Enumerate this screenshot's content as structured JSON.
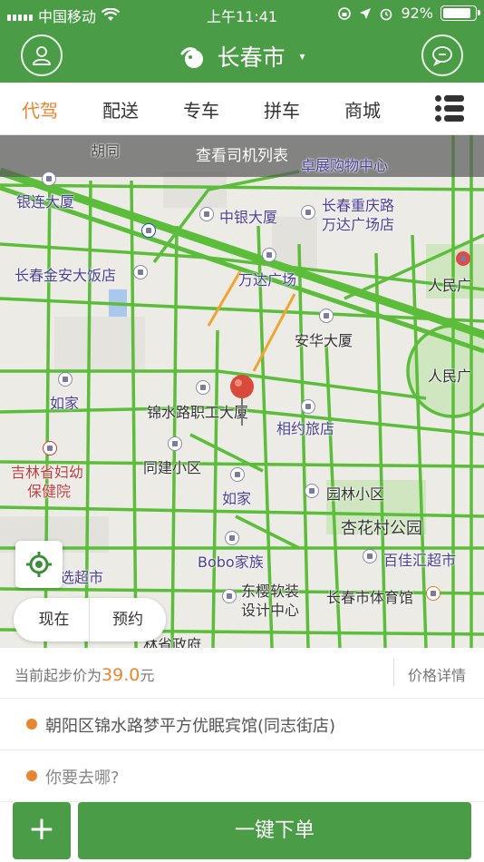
{
  "status_bar": {
    "carrier": "中国移动",
    "time": "上午11:41",
    "battery_percent": "92%",
    "battery_level": 0.92
  },
  "header": {
    "city": "长春市",
    "caret": "▾"
  },
  "tabs": [
    {
      "label": "代驾",
      "active": true
    },
    {
      "label": "配送",
      "active": false
    },
    {
      "label": "专车",
      "active": false
    },
    {
      "label": "拼车",
      "active": false
    },
    {
      "label": "商城",
      "active": false
    }
  ],
  "map": {
    "driver_list_label": "查看司机列表",
    "labels": {
      "zhuozhan": "卓展购物中心",
      "yinlian": "银连大厦",
      "zhongyin": "中银大厦",
      "chongqing_1": "长春重庆路",
      "chongqing_2": "万达广场店",
      "jinan": "长春金安大饭店",
      "wanda": "万达广场",
      "renmin_1": "人民广",
      "anhua": "安华大厦",
      "renmin_2": "人民广",
      "rujia_1": "如家",
      "jinshui": "锦水路职工大厦",
      "xiangyue": "相约旅店",
      "jilin_1": "吉林省妇幼",
      "jilin_2": "保健院",
      "tongjian": "同建小区",
      "rujia_2": "如家",
      "yuanlin": "园林小区",
      "xinghua": "杏花村公园",
      "bobo": "Bobo家族",
      "baijiahui": "百佳汇超市",
      "xuan": "选超市",
      "dongying_1": "东樱软装",
      "dongying_2": "设计中心",
      "tiyuguan": "长春市体育馆",
      "zhengfu": "林省政府",
      "hutong": "胡同"
    }
  },
  "time_toggle": {
    "now": "现在",
    "later": "预约"
  },
  "price": {
    "prefix": "当前起步价为",
    "value": "39.0",
    "unit": "元",
    "detail": "价格详情"
  },
  "address": {
    "from": "朝阳区锦水路梦平方优眠宾馆(同志街店)",
    "to_placeholder": "你要去哪?"
  },
  "actions": {
    "plus": "+",
    "order": "一键下单"
  },
  "colors": {
    "brand_green": "#4a9d46",
    "accent_orange": "#e9852e",
    "road_green": "#5bbd3a"
  }
}
